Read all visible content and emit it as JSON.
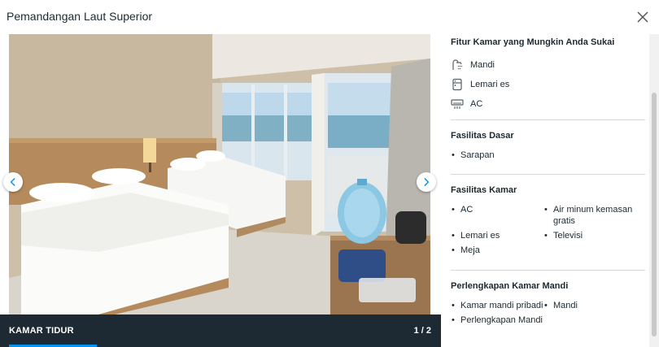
{
  "modal": {
    "title": "Pemandangan Laut Superior",
    "close_icon": "close-icon"
  },
  "gallery": {
    "caption": "KAMAR TIDUR",
    "counter": "1 / 2",
    "progress": 0.5,
    "prev_icon": "chevron-left-icon",
    "next_icon": "chevron-right-icon"
  },
  "details": {
    "features": {
      "title": "Fitur Kamar yang Mungkin Anda Sukai",
      "items": [
        {
          "icon": "shower-icon",
          "label": "Mandi"
        },
        {
          "icon": "fridge-icon",
          "label": "Lemari es"
        },
        {
          "icon": "ac-icon",
          "label": "AC"
        }
      ]
    },
    "basic": {
      "title": "Fasilitas Dasar",
      "items": [
        "Sarapan"
      ]
    },
    "room": {
      "title": "Fasilitas Kamar",
      "items": [
        "AC",
        "Air minum kemasan gratis",
        "Lemari es",
        "Televisi",
        "Meja"
      ]
    },
    "bathroom": {
      "title": "Perlengkapan Kamar Mandi",
      "items": [
        "Kamar mandi pribadi",
        "Mandi",
        "Perlengkapan Mandi"
      ]
    }
  },
  "colors": {
    "accent": "#0194f3",
    "caption_bg": "#1d2a33",
    "text": "#1c2930"
  }
}
